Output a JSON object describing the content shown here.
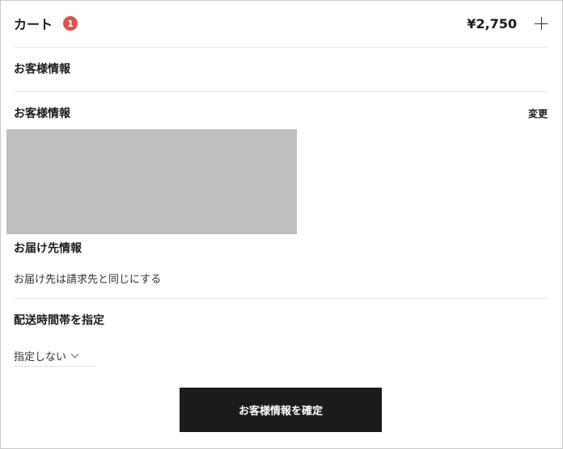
{
  "cart": {
    "label": "カート",
    "badge_count": "1",
    "total": "¥2,750",
    "badge_color": "#d9534f"
  },
  "sections": {
    "customer_header": "お客様情報",
    "customer_info_title": "お客様情報",
    "change_label": "変更",
    "shipping_title": "お届け先情報",
    "shipping_option_text": "お届け先は請求先と同じにする",
    "delivery_time_title": "配送時間帯を指定",
    "delivery_time_value": "指定しない"
  },
  "actions": {
    "confirm_label": "お客様情報を確定"
  },
  "icons": {
    "add": "plus-icon",
    "dropdown": "chevron-down-icon"
  }
}
